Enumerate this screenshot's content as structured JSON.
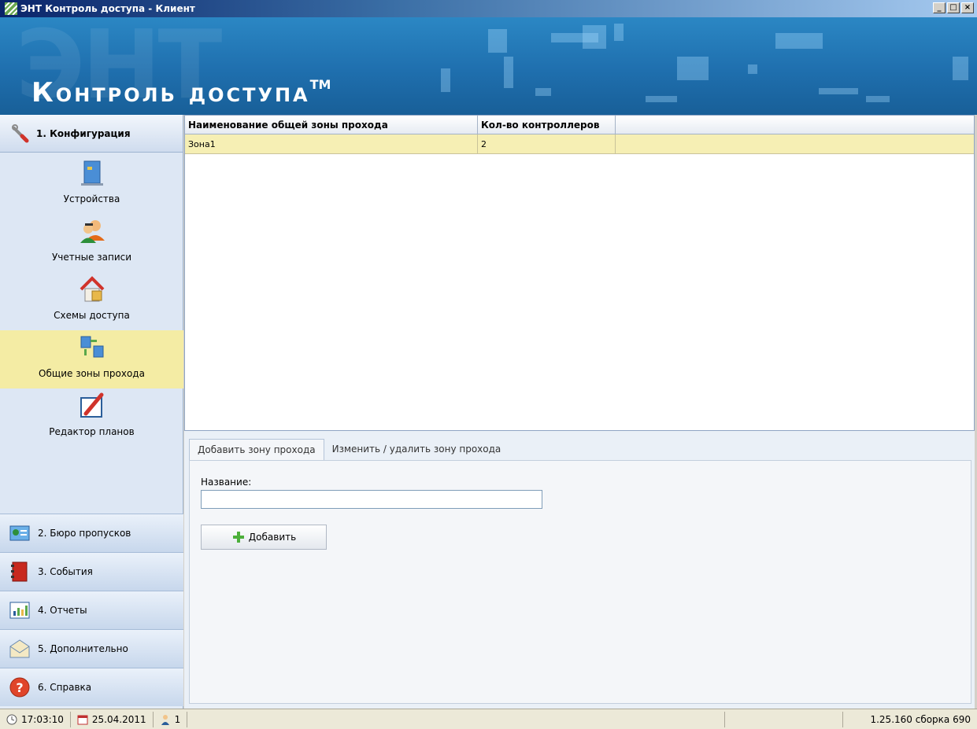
{
  "window": {
    "title": "ЭНТ Контроль доступа - Клиент",
    "controls": [
      "_",
      "□",
      "×"
    ]
  },
  "banner": {
    "logo": "Контроль доступа",
    "trademark": "TM",
    "watermark": "ЭНТ"
  },
  "nav": {
    "section_title": "1. Конфигурация",
    "items": [
      {
        "label": "Устройства",
        "icon": "server-icon"
      },
      {
        "label": "Учетные записи",
        "icon": "users-icon"
      },
      {
        "label": "Схемы доступа",
        "icon": "house-lock-icon"
      },
      {
        "label": "Общие зоны прохода",
        "icon": "network-zones-icon",
        "active": true
      },
      {
        "label": "Редактор планов",
        "icon": "plan-editor-icon"
      }
    ],
    "sections": [
      {
        "label": "2. Бюро пропусков",
        "icon": "id-card-icon"
      },
      {
        "label": "3. События",
        "icon": "events-book-icon"
      },
      {
        "label": "4. Отчеты",
        "icon": "reports-chart-icon"
      },
      {
        "label": "5. Дополнительно",
        "icon": "envelope-icon"
      },
      {
        "label": "6. Справка",
        "icon": "help-icon"
      }
    ]
  },
  "table": {
    "columns": [
      "Наименование общей зоны прохода",
      "Кол-во контроллеров",
      ""
    ],
    "rows": [
      [
        "Зона1",
        "2",
        ""
      ]
    ]
  },
  "form": {
    "tabs": [
      "Добавить зону прохода",
      "Изменить / удалить зону прохода"
    ],
    "name_label": "Название:",
    "name_value": "",
    "add_button": "Добавить"
  },
  "status": {
    "time": "17:03:10",
    "date": "25.04.2011",
    "users": "1",
    "version": "1.25.160 сборка 690"
  },
  "colors": {
    "banner": "#1f6fae",
    "active_item": "#f4eca4",
    "selected_row": "#f6efb4"
  }
}
